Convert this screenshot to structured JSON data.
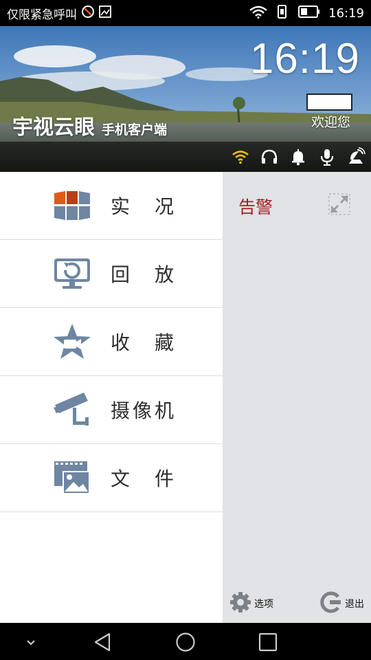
{
  "status_bar": {
    "carrier": "仅限紧急呼叫",
    "time": "16:19",
    "icons": [
      "no-sim-icon",
      "image-notification-icon",
      "wifi-icon",
      "vibrate-icon",
      "battery-icon"
    ]
  },
  "header": {
    "big_time": "16:19",
    "welcome": "欢迎您",
    "app_name": "宇视云眼",
    "app_subtitle": "手机客户端",
    "toolbar_icons": [
      "wifi-icon",
      "headphones-icon",
      "bell-icon",
      "microphone-icon",
      "satellite-icon"
    ]
  },
  "menu": {
    "items": [
      {
        "label": "实　况",
        "icon": "live-view-icon"
      },
      {
        "label": "回　放",
        "icon": "playback-icon"
      },
      {
        "label": "收　藏",
        "icon": "favorites-icon"
      },
      {
        "label": "摄像机",
        "icon": "camera-icon"
      },
      {
        "label": "文　件",
        "icon": "files-icon"
      }
    ]
  },
  "panel": {
    "title": "告警",
    "options_label": "选项",
    "exit_label": "退出"
  },
  "colors": {
    "alarm_red": "#a51d1d",
    "icon_blue": "#6e86a2",
    "icon_orange": "#e05a18",
    "panel_bg": "#e1e3e6",
    "wifi_yellow": "#f2c200"
  }
}
